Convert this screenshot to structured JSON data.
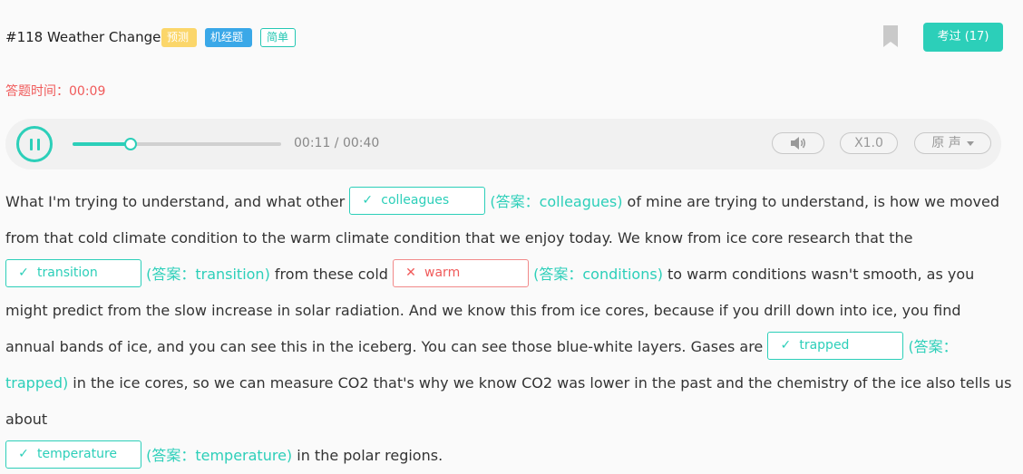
{
  "header": {
    "title": "#118 Weather Change",
    "tags": [
      "预测",
      "机经题",
      "简单"
    ],
    "passed_button": "考过 (17)"
  },
  "timer": {
    "label": "答题时间：",
    "value": "00:09"
  },
  "player": {
    "time": "00:11 / 00:40",
    "progress": 0.275,
    "speed": "X1.0",
    "voice": "原 声"
  },
  "passage": {
    "answer_prefix": "(答案：",
    "answer_suffix": ")",
    "t1": "What I'm trying to understand, and what other ",
    "b1": {
      "value": "colleagues",
      "answer": "colleagues",
      "correct": true
    },
    "t2": " of mine are trying to understand, is how we moved from that cold climate condition to the warm climate condition that we enjoy today. We know from ice core research that the ",
    "b2": {
      "value": "transition",
      "answer": "transition",
      "correct": true
    },
    "t3": " from these cold ",
    "b3": {
      "value": "warm",
      "answer": "conditions",
      "correct": false
    },
    "t4": " to warm conditions wasn't smooth, as you might predict from the slow increase in solar radiation. And we know this from ice cores, because if you drill down into ice, you find annual bands of ice, and you can see this in the iceberg. You can see those blue-white layers. Gases are ",
    "b4": {
      "value": "trapped",
      "answer": "trapped",
      "correct": true
    },
    "t5": " in the ice cores, so we can measure CO2 that's why we know CO2 was lower in the past and the chemistry of the ice also tells us about ",
    "b5": {
      "value": "temperature",
      "answer": "temperature",
      "correct": true
    },
    "t6": " in the polar regions.",
    "check_mark": "✓",
    "cross_mark": "✕"
  },
  "colors": {
    "accent": "#2ccfb9",
    "error": "#f05a5a",
    "tag_predict": "#fbd66a",
    "tag_machine": "#3aa8e8"
  },
  "icons": {
    "bookmark": "bookmark-icon",
    "pause": "pause-icon",
    "volume": "volume-icon",
    "caret": "caret-down-icon"
  }
}
